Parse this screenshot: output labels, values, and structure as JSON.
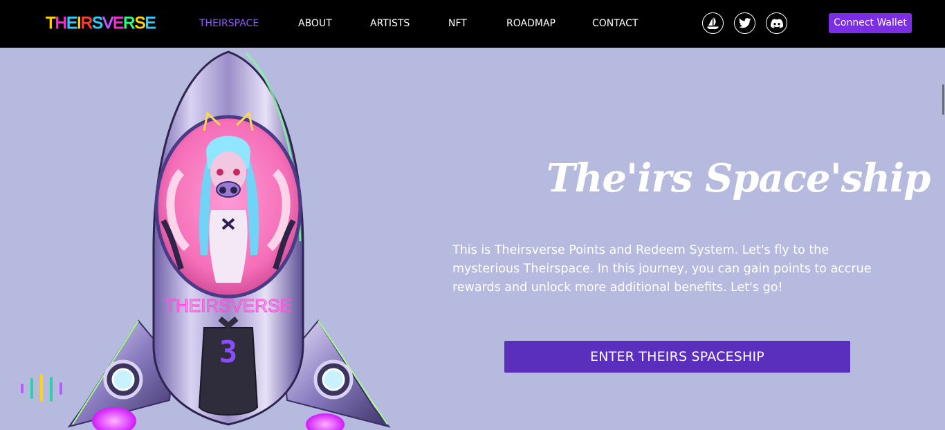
{
  "nav": {
    "logo_letters": [
      {
        "ch": "T",
        "color": "#ffd400"
      },
      {
        "ch": "H",
        "color": "#ff2bd6"
      },
      {
        "ch": "E",
        "color": "#2bd0ff"
      },
      {
        "ch": "I",
        "color": "#ffd400"
      },
      {
        "ch": "R",
        "color": "#ff3b3b"
      },
      {
        "ch": "S",
        "color": "#2bd0ff"
      },
      {
        "ch": "V",
        "color": "#b85bff"
      },
      {
        "ch": "E",
        "color": "#ff2bd6"
      },
      {
        "ch": "R",
        "color": "#2bff8a"
      },
      {
        "ch": "S",
        "color": "#ffd400"
      },
      {
        "ch": "E",
        "color": "#2bd0ff"
      }
    ],
    "links": [
      {
        "label": "THEIRSPACE",
        "active": true
      },
      {
        "label": "ABOUT",
        "active": false
      },
      {
        "label": "ARTISTS",
        "active": false
      },
      {
        "label": "NFT",
        "active": false
      },
      {
        "label": "ROADMAP",
        "active": false
      },
      {
        "label": "CONTACT",
        "active": false
      }
    ],
    "social_icons": [
      "opensea-icon",
      "twitter-icon",
      "discord-icon"
    ],
    "connect_label": "Connect Wallet"
  },
  "hero": {
    "title": "The'irs Space'ship",
    "description": "This is Theirsverse Points and Redeem System. Let's fly to the mysterious Theirspace. In this journey, you can gain points to accrue rewards and unlock more additional benefits. Let's go!",
    "enter_label": "ENTER THEIRS SPACESHIP",
    "rocket_badge_text": "THEIRSVERSE",
    "rocket_number": "3"
  },
  "colors": {
    "nav_bg": "#000000",
    "page_bg": "#b7badf",
    "accent": "#7c2ee6",
    "active_link": "#8b5cf6",
    "enter_button": "#5b2fbd"
  }
}
